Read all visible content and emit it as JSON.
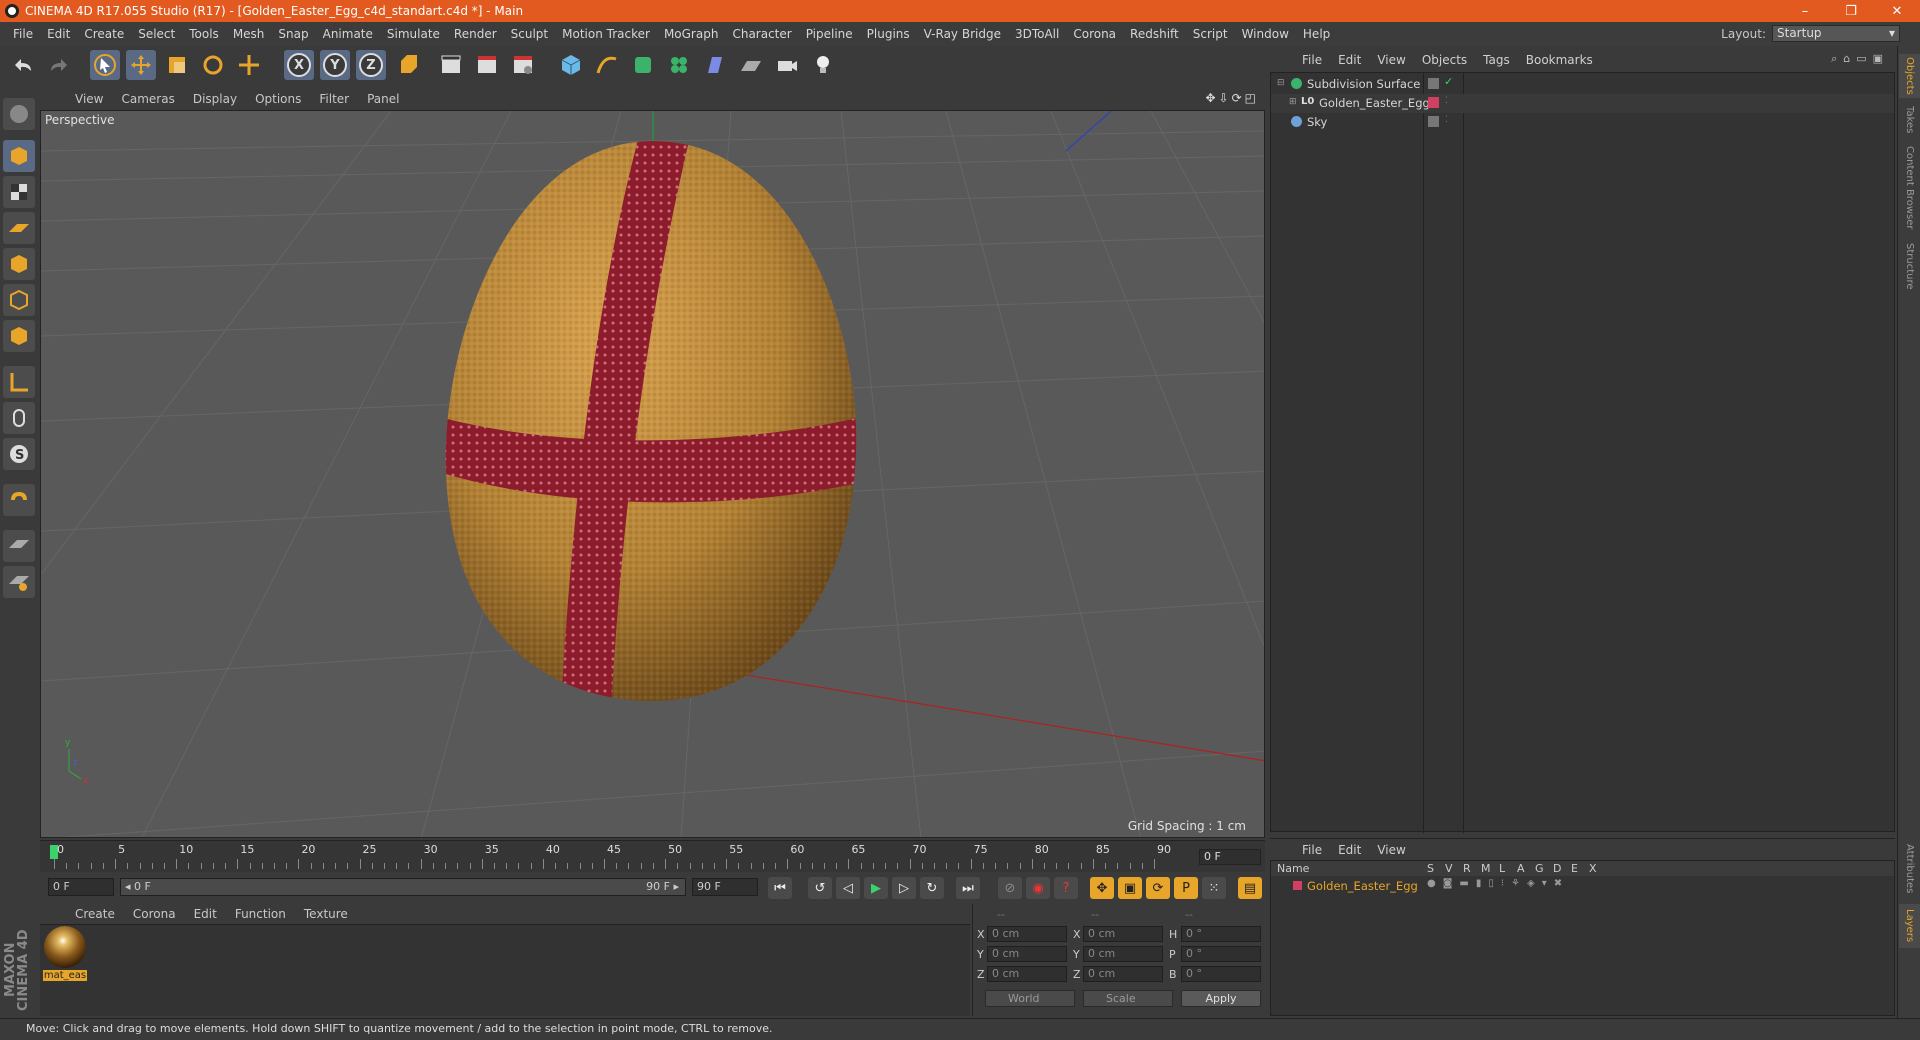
{
  "window": {
    "title": "CINEMA 4D R17.055 Studio (R17) - [Golden_Easter_Egg_c4d_standart.c4d *] - Main",
    "controls": [
      "–",
      "❐",
      "✕"
    ]
  },
  "menubar": {
    "items": [
      "File",
      "Edit",
      "Create",
      "Select",
      "Tools",
      "Mesh",
      "Snap",
      "Animate",
      "Simulate",
      "Render",
      "Sculpt",
      "Motion Tracker",
      "MoGraph",
      "Character",
      "Pipeline",
      "Plugins",
      "V-Ray Bridge",
      "3DToAll",
      "Corona",
      "Redshift",
      "Script",
      "Window",
      "Help"
    ],
    "layout_label": "Layout:",
    "layout_value": "Startup"
  },
  "viewport": {
    "menu": [
      "View",
      "Cameras",
      "Display",
      "Options",
      "Filter",
      "Panel"
    ],
    "camera_label": "Perspective",
    "grid_spacing": "Grid Spacing : 1 cm",
    "axis_y": "y",
    "axis_x": "x",
    "axis_z": "z",
    "nav_icons": "✥⇩⟳◰"
  },
  "timeline": {
    "ticks": [
      "0",
      "5",
      "10",
      "15",
      "20",
      "25",
      "30",
      "35",
      "40",
      "45",
      "50",
      "55",
      "60",
      "65",
      "70",
      "75",
      "80",
      "85",
      "90"
    ],
    "current_frame": "0 F"
  },
  "transport": {
    "start_field": "0 F",
    "range_start": "◂ 0 F",
    "range_end": "90 F ▸",
    "end_field": "90 F"
  },
  "material_manager": {
    "menu": [
      "Create",
      "Corona",
      "Edit",
      "Function",
      "Texture"
    ],
    "materials": [
      {
        "name": "mat_eas"
      }
    ]
  },
  "coordinates": {
    "headers": [
      "--",
      "--",
      "--"
    ],
    "rows": [
      {
        "l1": "X",
        "v1": "0 cm",
        "l2": "X",
        "v2": "0 cm",
        "l3": "H",
        "v3": "0 °"
      },
      {
        "l1": "Y",
        "v1": "0 cm",
        "l2": "Y",
        "v2": "0 cm",
        "l3": "P",
        "v3": "0 °"
      },
      {
        "l1": "Z",
        "v1": "0 cm",
        "l2": "Z",
        "v2": "0 cm",
        "l3": "B",
        "v3": "0 °"
      }
    ],
    "mode_world": "World",
    "mode_scale": "Scale",
    "apply": "Apply"
  },
  "object_manager": {
    "menu": [
      "File",
      "Edit",
      "View",
      "Objects",
      "Tags",
      "Bookmarks"
    ],
    "objects": [
      {
        "name": "Subdivision Surface",
        "icon": "subdivision-icon"
      },
      {
        "name": "Golden_Easter_Egg",
        "icon": "polygon-object-icon"
      },
      {
        "name": "Sky",
        "icon": "sky-icon"
      }
    ]
  },
  "layer_manager": {
    "menu": [
      "File",
      "Edit",
      "View"
    ],
    "columns": [
      "Name",
      "S",
      "V",
      "R",
      "M",
      "L",
      "A",
      "G",
      "D",
      "E",
      "X"
    ],
    "layers": [
      {
        "name": "Golden_Easter_Egg"
      }
    ]
  },
  "side_tabs": [
    "Objects",
    "Takes",
    "Content Browser",
    "Structure",
    "Attributes",
    "Layers"
  ],
  "status": "Move: Click and drag to move elements. Hold down SHIFT to quantize movement / add to the selection in point mode, CTRL to remove.",
  "branding": {
    "logo": "MAXON CINEMA 4D"
  },
  "colors": {
    "accent": "#e7a52a",
    "titlebar": "#e25a20",
    "egg": "#b98a3a",
    "ribbon": "#8c1b2c"
  }
}
